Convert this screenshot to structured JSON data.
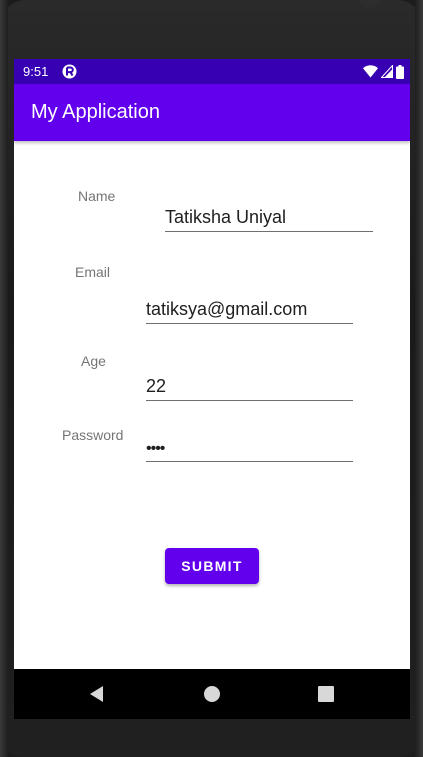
{
  "status_bar": {
    "time": "9:51",
    "app_icon": "app-notification-icon",
    "icons": [
      "wifi-icon",
      "cell-signal-icon",
      "battery-icon"
    ]
  },
  "app_bar": {
    "title": "My Application",
    "color": "#6200ee"
  },
  "form": {
    "name": {
      "label": "Name",
      "value": "Tatiksha Uniyal"
    },
    "email": {
      "label": "Email",
      "value": "tatiksya@gmail.com"
    },
    "age": {
      "label": "Age",
      "value": "22"
    },
    "password": {
      "label": "Password",
      "value": "••••"
    },
    "submit_label": "SUBMIT"
  },
  "nav_bar": {
    "icons": [
      "back-icon",
      "home-icon",
      "recents-icon"
    ]
  },
  "colors": {
    "status_bar": "#3700b3",
    "accent": "#6200ee"
  }
}
